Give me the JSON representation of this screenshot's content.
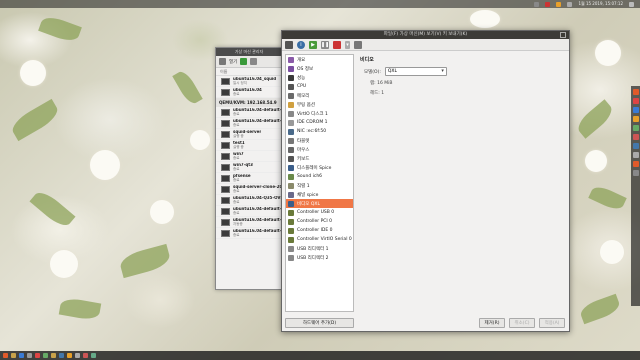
{
  "top_panel": {
    "clock": "1월 15 2019, 15:07:12"
  },
  "vm_manager": {
    "title": "가상 머신 관리자",
    "toolbar": {
      "open_label": "열기"
    },
    "column_header": "이름",
    "host": "QEMU/KVM: 192.168.54.9",
    "top_vms": [
      {
        "name": "ubuntu16.04_squid",
        "state": "일시 정지"
      },
      {
        "name": "ubuntu16.04",
        "state": "종료"
      }
    ],
    "vms": [
      {
        "name": "ubuntu16.04-default-sh",
        "state": "종료"
      },
      {
        "name": "ubuntu16.04-default-sh",
        "state": "종료"
      },
      {
        "name": "squid-server",
        "state": "실행 중"
      },
      {
        "name": "test1",
        "state": "실행 중"
      },
      {
        "name": "win7",
        "state": "종료"
      },
      {
        "name": "win7-qt3",
        "state": "종료"
      },
      {
        "name": "pfsense",
        "state": "종료"
      },
      {
        "name": "squid-server-clone-2018",
        "state": "종료"
      },
      {
        "name": "ubuntu16.04-Q35-OVMF",
        "state": "종료"
      },
      {
        "name": "ubuntu16.04-default-sq",
        "state": "종료"
      },
      {
        "name": "ubuntu16.04-default-SQ",
        "state": "자동증"
      },
      {
        "name": "ubuntu16.04-default-sq",
        "state": "종료"
      }
    ]
  },
  "vm_details": {
    "title": "파일(F)  가상 머신(M)  보기(V)  키 보내기(K)",
    "hardware_items": [
      {
        "label": "개요",
        "color": "#8a5aa8"
      },
      {
        "label": "OS 정보",
        "color": "#7a4ea0"
      },
      {
        "label": "성능",
        "color": "#3a3a3a"
      },
      {
        "label": "CPU",
        "color": "#555555"
      },
      {
        "label": "메모리",
        "color": "#6a6a6a"
      },
      {
        "label": "부팅 옵션",
        "color": "#d0a040"
      },
      {
        "label": "VirtIO 디스크 1",
        "color": "#888888"
      },
      {
        "label": "IDE CDROM 1",
        "color": "#999999"
      },
      {
        "label": "NIC :ec:6f:50",
        "color": "#4a6a8a"
      },
      {
        "label": "타블렛",
        "color": "#777777"
      },
      {
        "label": "마우스",
        "color": "#666666"
      },
      {
        "label": "키보드",
        "color": "#555555"
      },
      {
        "label": "디스플레이 Spice",
        "color": "#3b5e8a"
      },
      {
        "label": "Sound ich6",
        "color": "#6a8a4a"
      },
      {
        "label": "직렬 1",
        "color": "#8a8a6a"
      },
      {
        "label": "채널 spice",
        "color": "#6a6a8a"
      },
      {
        "label": "비디오 QXL",
        "color": "#3b5e8a",
        "selected": true
      },
      {
        "label": "Controller USB 0",
        "color": "#6a7a3a"
      },
      {
        "label": "Controller PCI 0",
        "color": "#6a7a3a"
      },
      {
        "label": "Controller IDE 0",
        "color": "#6a7a3a"
      },
      {
        "label": "Controller VirtIO Serial 0",
        "color": "#6a7a3a"
      },
      {
        "label": "USB 리디렉터 1",
        "color": "#888888"
      },
      {
        "label": "USB 리디렉터 2",
        "color": "#888888"
      }
    ],
    "add_hardware_label": "하드웨어 추가(D)",
    "section_title": "비디오",
    "model_label": "모델(O):",
    "model_value": "QXL",
    "ram_label": "램:",
    "ram_value": "16 MiB",
    "heads_label": "헤드:",
    "heads_value": "1",
    "buttons": {
      "remove": "제거(R)",
      "cancel": "취소(C)",
      "apply": "적용(A)"
    }
  }
}
